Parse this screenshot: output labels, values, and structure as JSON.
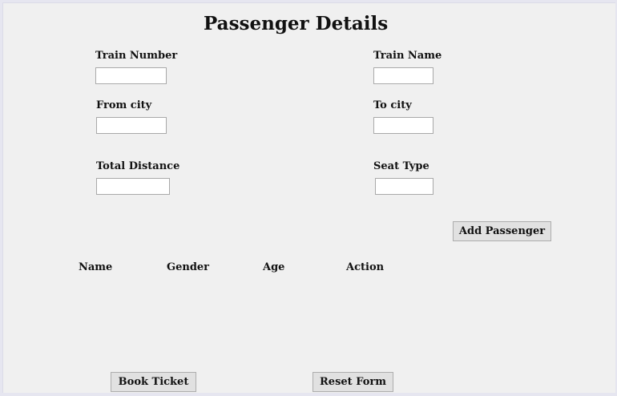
{
  "form": {
    "title": "Passenger Details",
    "fields": {
      "train_number": {
        "label": "Train Number",
        "value": "",
        "placeholder": ""
      },
      "train_name": {
        "label": "Train Name",
        "value": "",
        "placeholder": ""
      },
      "from_city": {
        "label": "From city",
        "value": "",
        "placeholder": ""
      },
      "to_city": {
        "label": "To city",
        "value": "",
        "placeholder": ""
      },
      "total_distance": {
        "label": "Total Distance",
        "value": "",
        "placeholder": ""
      },
      "seat_type": {
        "label": "Seat Type",
        "value": "",
        "placeholder": ""
      }
    },
    "add_passenger_label": "Add Passenger"
  },
  "passenger_table": {
    "columns": [
      "Name",
      "Gender",
      "Age",
      "Action"
    ],
    "rows": []
  },
  "actions": {
    "book_ticket_label": "Book Ticket",
    "reset_form_label": "Reset Form"
  }
}
